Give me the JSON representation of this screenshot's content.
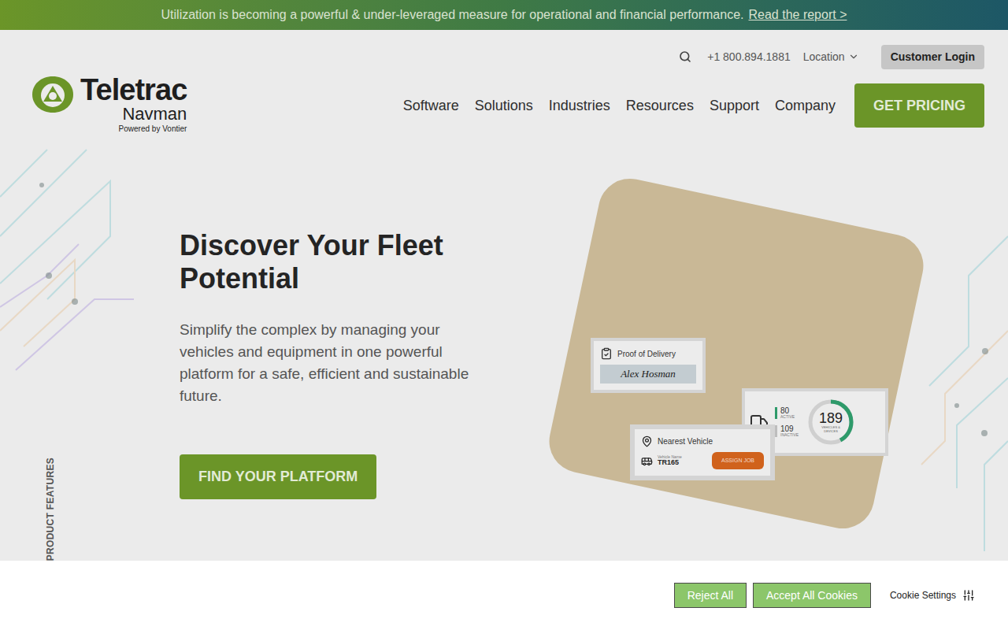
{
  "announcement": {
    "text": "Utilization is becoming a powerful & under-leveraged measure for operational and financial performance.",
    "link": "Read the report >"
  },
  "utility": {
    "phone": "+1 800.894.1881",
    "location": "Location",
    "login": "Customer Login"
  },
  "logo": {
    "name": "Teletrac",
    "sub": "Navman",
    "tagline": "Powered by Vontier"
  },
  "nav": [
    "Software",
    "Solutions",
    "Industries",
    "Resources",
    "Support",
    "Company"
  ],
  "cta": "GET PRICING",
  "hero": {
    "title": "Discover Your Fleet Potential",
    "body": "Simplify the complex by managing your vehicles and equipment in one powerful platform for a safe, efficient and sustainable future.",
    "button": "FIND YOUR PLATFORM"
  },
  "side_label": "PRODUCT FEATURES",
  "cards": {
    "proof": {
      "title": "Proof of Delivery",
      "signature": "Alex Hosman"
    },
    "stats": {
      "active": "80",
      "active_label": "ACTIVE",
      "inactive": "109",
      "inactive_label": "INACTIVE",
      "total": "189",
      "total_label": "VEHICLES & DEVICES",
      "level": 0.42
    },
    "nearest": {
      "title": "Nearest Vehicle",
      "vehicle_label": "Vehicle Name",
      "vehicle": "TR165",
      "button": "ASSIGN JOB"
    }
  },
  "cookie": {
    "reject": "Reject All",
    "accept": "Accept All Cookies",
    "settings": "Cookie Settings"
  }
}
